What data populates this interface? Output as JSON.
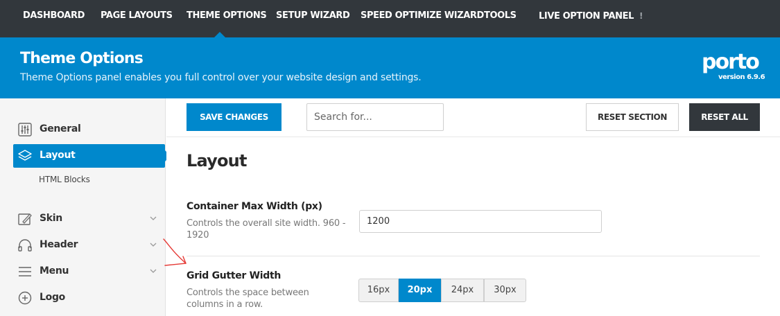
{
  "topnav": {
    "items": [
      "DASHBOARD",
      "PAGE LAYOUTS",
      "THEME OPTIONS",
      "SETUP WIZARD",
      "SPEED OPTIMIZE WIZARD",
      "TOOLS",
      "LIVE OPTION PANEL"
    ],
    "live_badge": "!"
  },
  "banner": {
    "title": "Theme Options",
    "subtitle": "Theme Options panel enables you full control over your website design and settings.",
    "logo": "porto",
    "version": "version 6.9.6"
  },
  "sidebar": {
    "items": [
      {
        "label": "General",
        "icon": "sliders-icon"
      },
      {
        "label": "Layout",
        "icon": "layers-icon",
        "active": true
      },
      {
        "label": "Skin",
        "icon": "paint-icon"
      },
      {
        "label": "Header",
        "icon": "headphones-icon"
      },
      {
        "label": "Menu",
        "icon": "menu-icon"
      },
      {
        "label": "Logo",
        "icon": "plus-circle-icon"
      }
    ],
    "sub_item": "HTML Blocks"
  },
  "toolbar": {
    "save_label": "SAVE CHANGES",
    "search_placeholder": "Search for...",
    "reset_section_label": "RESET SECTION",
    "reset_all_label": "RESET ALL"
  },
  "main": {
    "section_title": "Layout",
    "fields": [
      {
        "title": "Container Max Width (px)",
        "description": "Controls the overall site width. 960 - 1920",
        "value": "1200"
      },
      {
        "title": "Grid Gutter Width",
        "description": "Controls the space between columns in a row.",
        "options": [
          "16px",
          "20px",
          "24px",
          "30px"
        ],
        "selected": "20px"
      }
    ]
  },
  "colors": {
    "accent": "#0088cc",
    "dark": "#32373c",
    "annotation": "#e53935"
  }
}
